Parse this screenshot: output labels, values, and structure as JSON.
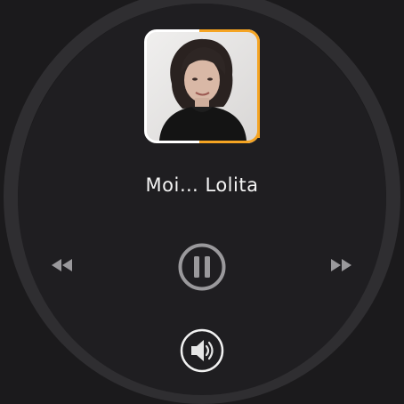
{
  "player": {
    "track_title": "Moi… Lolita",
    "album_art_label": "album-art",
    "progress_color": "#f5a423"
  },
  "controls": {
    "previous": "rewind-icon",
    "play_pause": "pause-icon",
    "next": "fast-forward-icon",
    "volume": "volume-icon"
  },
  "colors": {
    "background": "#1b1a1c",
    "ring": "#2f2e31",
    "text": "#f4f4f4",
    "icon": "#9a999c"
  }
}
